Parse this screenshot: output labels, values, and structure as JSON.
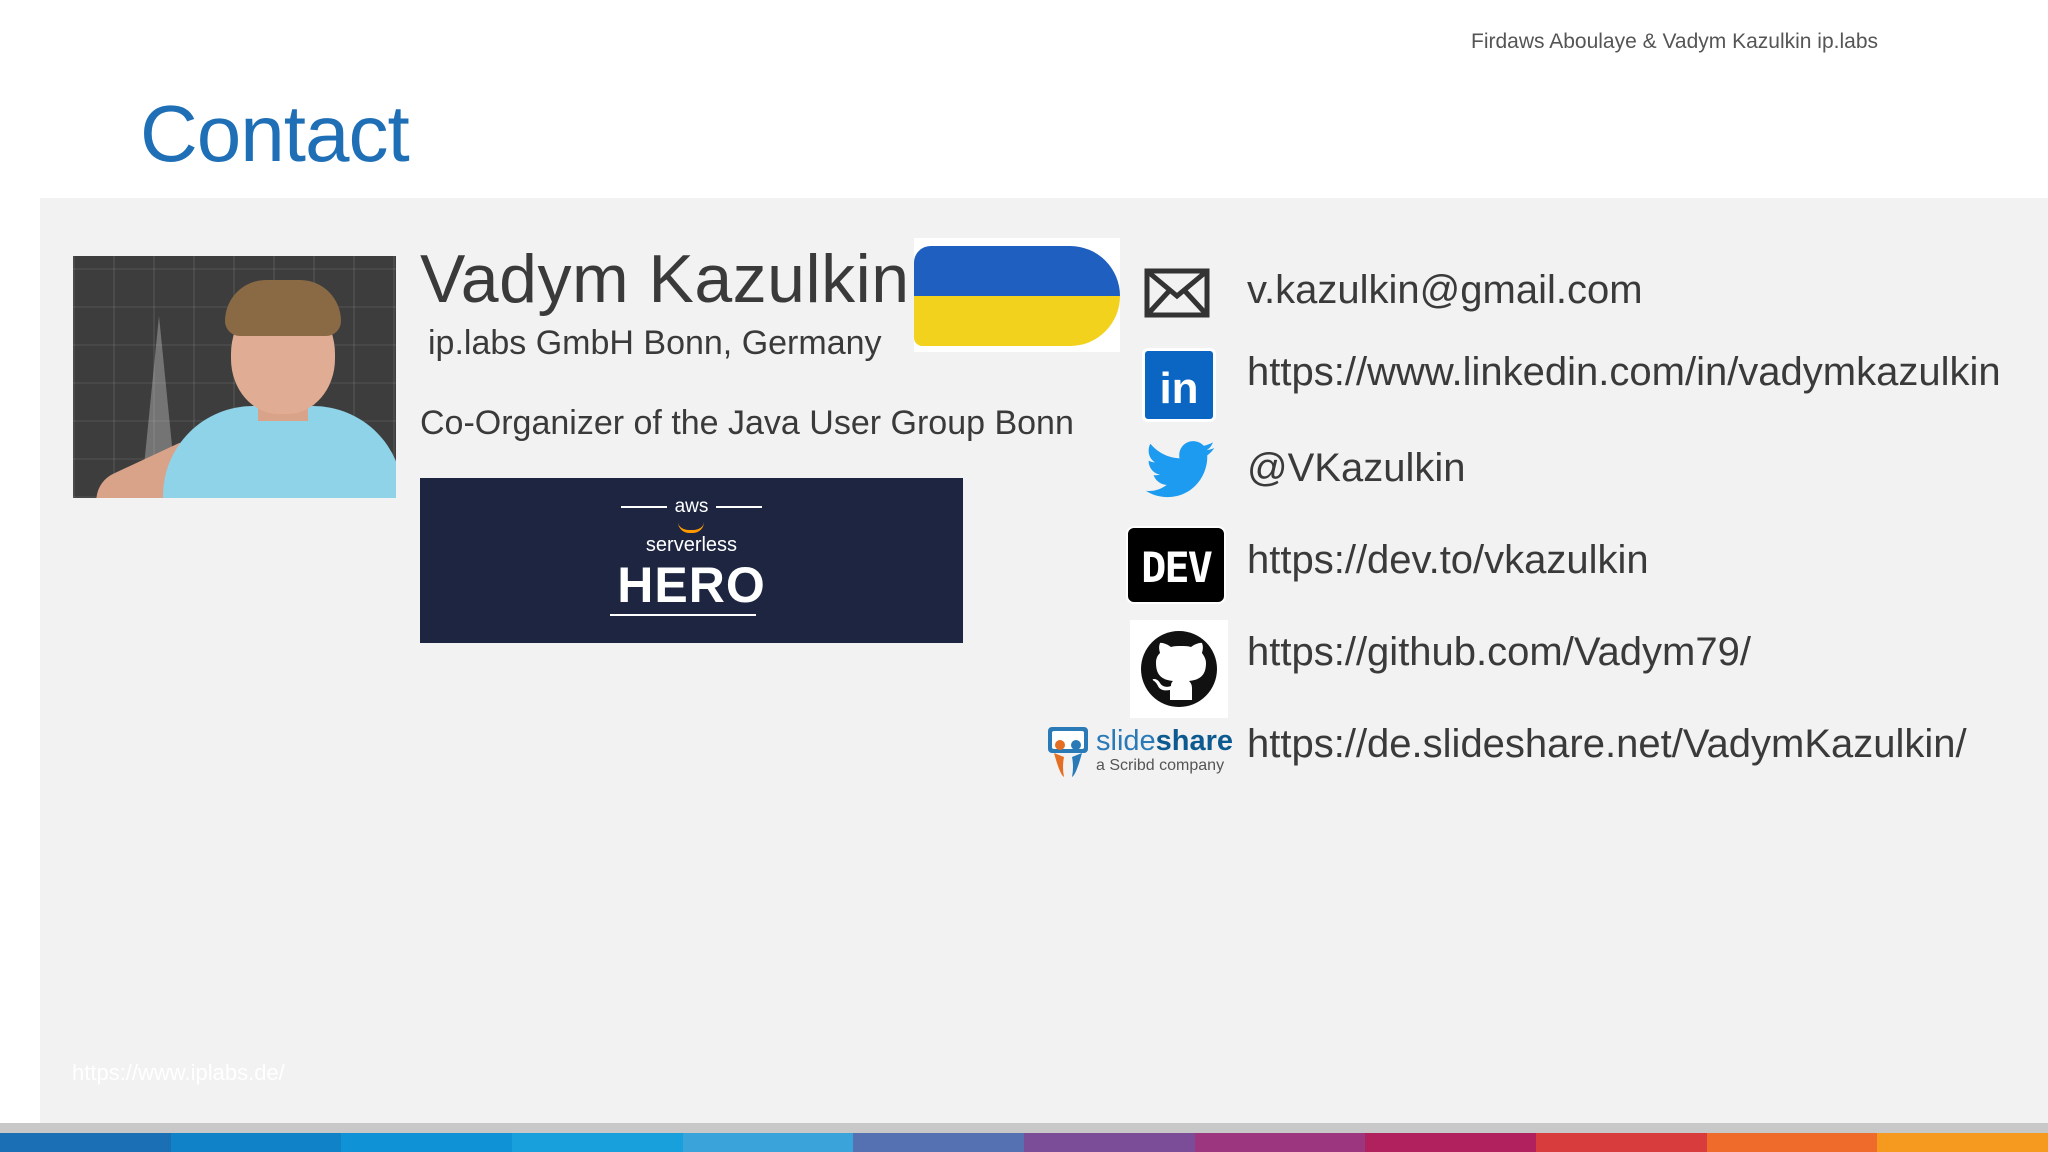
{
  "header": {
    "authors": "Firdaws Aboulaye & Vadym Kazulkin ip.labs"
  },
  "slide": {
    "title": "Contact"
  },
  "profile": {
    "name": "Vadym Kazulkin",
    "company": "ip.labs GmbH Bonn, Germany",
    "role": "Co-Organizer of the Java User Group Bonn"
  },
  "badge": {
    "aws": "aws",
    "subtitle": "serverless",
    "title": "HERO"
  },
  "contacts": {
    "email": "v.kazulkin@gmail.com",
    "linkedin": "https://www.linkedin.com/in/vadymkazulkin",
    "twitter": "@VKazulkin",
    "devto": "https://dev.to/vkazulkin",
    "github": "https://github.com/Vadym79/",
    "slideshare": "https://de.slideshare.net/VadymKazulkin/"
  },
  "icons": {
    "linkedin_text": "in",
    "dev_text": "DEV",
    "slideshare_brand_a": "slide",
    "slideshare_brand_b": "share",
    "slideshare_tagline": "a Scribd company"
  },
  "footer": {
    "url": "https://www.iplabs.de/",
    "stripe_colors": [
      "#1b6fb5",
      "#0f82c8",
      "#0f93d6",
      "#17a0dc",
      "#3aa3da",
      "#5571b1",
      "#7b4d99",
      "#9b367f",
      "#b0215e",
      "#d93c3c",
      "#ee6b2b",
      "#f59a1e"
    ]
  },
  "colors": {
    "title": "#1f6fb6",
    "panel": "#f2f2f2",
    "linkedin": "#0a66c2",
    "twitter": "#1d9bf0",
    "hero_bg": "#1d2541"
  }
}
